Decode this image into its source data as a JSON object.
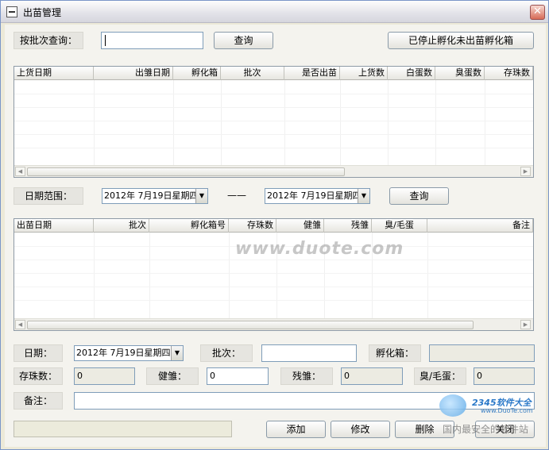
{
  "window": {
    "title": "出苗管理",
    "close": "✕"
  },
  "query": {
    "batch_label": "按批次查询：",
    "batch_value": "",
    "query_button": "查询",
    "stopped_button": "已停止孵化未出苗孵化箱"
  },
  "grid1": {
    "columns": [
      "上货日期",
      "出雏日期",
      "孵化箱",
      "批次",
      "是否出苗",
      "上货数",
      "白蛋数",
      "臭蛋数",
      "存珠数"
    ]
  },
  "date_range": {
    "label": "日期范围：",
    "from": "2012年 7月19日星期四",
    "separator": "——",
    "to": "2012年 7月19日星期四",
    "query_button": "查询"
  },
  "grid2": {
    "columns": [
      "出苗日期",
      "批次",
      "孵化箱号",
      "存珠数",
      "健雏",
      "残雏",
      "臭/毛蛋",
      "备注"
    ]
  },
  "form": {
    "date_label": "日期：",
    "date_value": "2012年 7月19日星期四",
    "batch_label": "批次：",
    "batch_value": "",
    "incubator_label": "孵化箱：",
    "incubator_value": "",
    "stock_label": "存珠数：",
    "stock_value": "0",
    "healthy_label": "健雏：",
    "healthy_value": "0",
    "weak_label": "残雏：",
    "weak_value": "0",
    "bad_label": "臭/毛蛋：",
    "bad_value": "0",
    "remark_label": "备注：",
    "remark_value": ""
  },
  "actions": {
    "add": "添加",
    "edit": "修改",
    "delete": "删除",
    "close": "关闭"
  },
  "watermarks": {
    "center": "www.duote.com",
    "brand": "2345软件大全",
    "site": "www.DuoTe.com",
    "slogan": "国内最安全的软件站"
  },
  "colors": {
    "window_border": "#7a96c8",
    "panel": "#f4f3ee",
    "close_button": "#d86a56"
  }
}
